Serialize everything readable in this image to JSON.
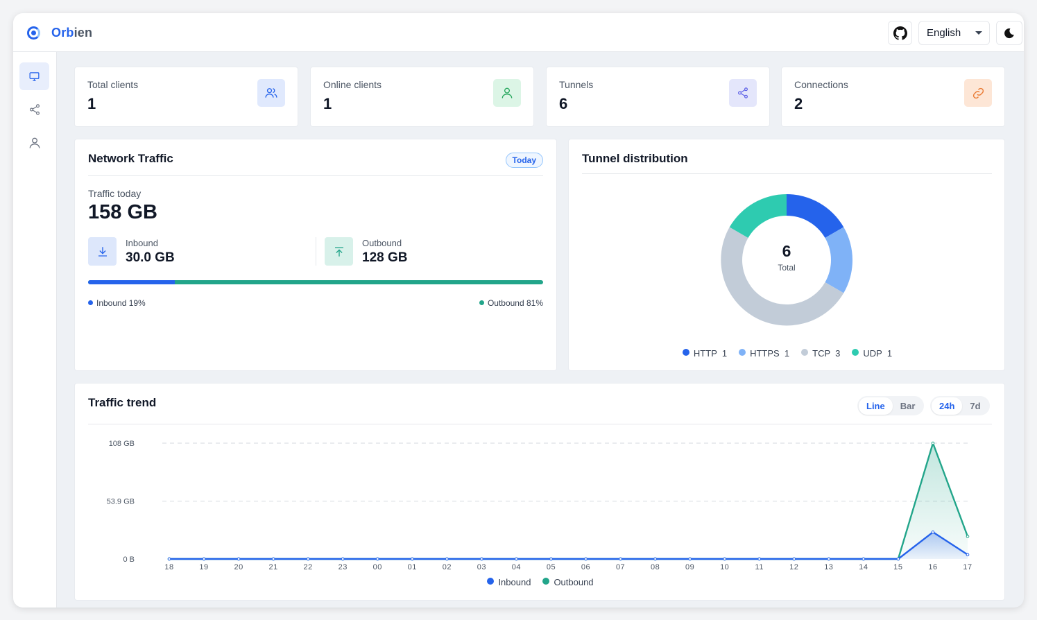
{
  "app": {
    "brand_prefix": "Orb",
    "brand_suffix": "ien",
    "language": "English"
  },
  "colors": {
    "accent": "#2563eb",
    "inbound": "#2563eb",
    "outbound": "#22a58a",
    "http": "#2563eb",
    "https": "#7fb2f7",
    "tcp": "#c2ccd8",
    "udp": "#2ecbb0"
  },
  "sidebar": {
    "items": [
      {
        "icon": "monitor-icon",
        "active": true
      },
      {
        "icon": "share-icon"
      },
      {
        "icon": "user-icon"
      }
    ]
  },
  "stats": [
    {
      "label": "Total clients",
      "value": "1",
      "icon": "users-icon"
    },
    {
      "label": "Online clients",
      "value": "1",
      "icon": "user-icon"
    },
    {
      "label": "Tunnels",
      "value": "6",
      "icon": "share-icon"
    },
    {
      "label": "Connections",
      "value": "2",
      "icon": "link-icon"
    }
  ],
  "traffic": {
    "title": "Network Traffic",
    "period": "Today",
    "today_label": "Traffic today",
    "today_value": "158 GB",
    "inbound_label": "Inbound",
    "inbound_value": "30.0 GB",
    "outbound_label": "Outbound",
    "outbound_value": "128 GB",
    "inbound_fraction": 0.19,
    "inbound_legend": "Inbound 19%",
    "outbound_legend": "Outbound 81%"
  },
  "distribution": {
    "title": "Tunnel distribution",
    "total_value": "6",
    "total_label": "Total",
    "slices": [
      {
        "name": "HTTP",
        "value": 1
      },
      {
        "name": "HTTPS",
        "value": 1
      },
      {
        "name": "TCP",
        "value": 3
      },
      {
        "name": "UDP",
        "value": 1
      }
    ]
  },
  "trend": {
    "title": "Traffic trend",
    "view_tabs": [
      "Line",
      "Bar"
    ],
    "active_view": "Line",
    "range_tabs": [
      "24h",
      "7d"
    ],
    "active_range": "24h"
  },
  "chart_data": {
    "type": "area",
    "x": [
      "18",
      "19",
      "20",
      "21",
      "22",
      "23",
      "00",
      "01",
      "02",
      "03",
      "04",
      "05",
      "06",
      "07",
      "08",
      "09",
      "10",
      "11",
      "12",
      "13",
      "14",
      "15",
      "16",
      "17"
    ],
    "y_ticks": [
      "0 B",
      "53.9 GB",
      "108 GB"
    ],
    "ylim": [
      0,
      108
    ],
    "grid": true,
    "legend": "bottom",
    "series": [
      {
        "name": "Inbound",
        "values": [
          0,
          0,
          0,
          0,
          0,
          0,
          0,
          0,
          0,
          0,
          0,
          0,
          0,
          0,
          0,
          0,
          0,
          0,
          0,
          0,
          0,
          0,
          25,
          4
        ]
      },
      {
        "name": "Outbound",
        "values": [
          0,
          0,
          0,
          0,
          0,
          0,
          0,
          0,
          0,
          0,
          0,
          0,
          0,
          0,
          0,
          0,
          0,
          0,
          0,
          0,
          0,
          0,
          108,
          21
        ]
      }
    ]
  }
}
